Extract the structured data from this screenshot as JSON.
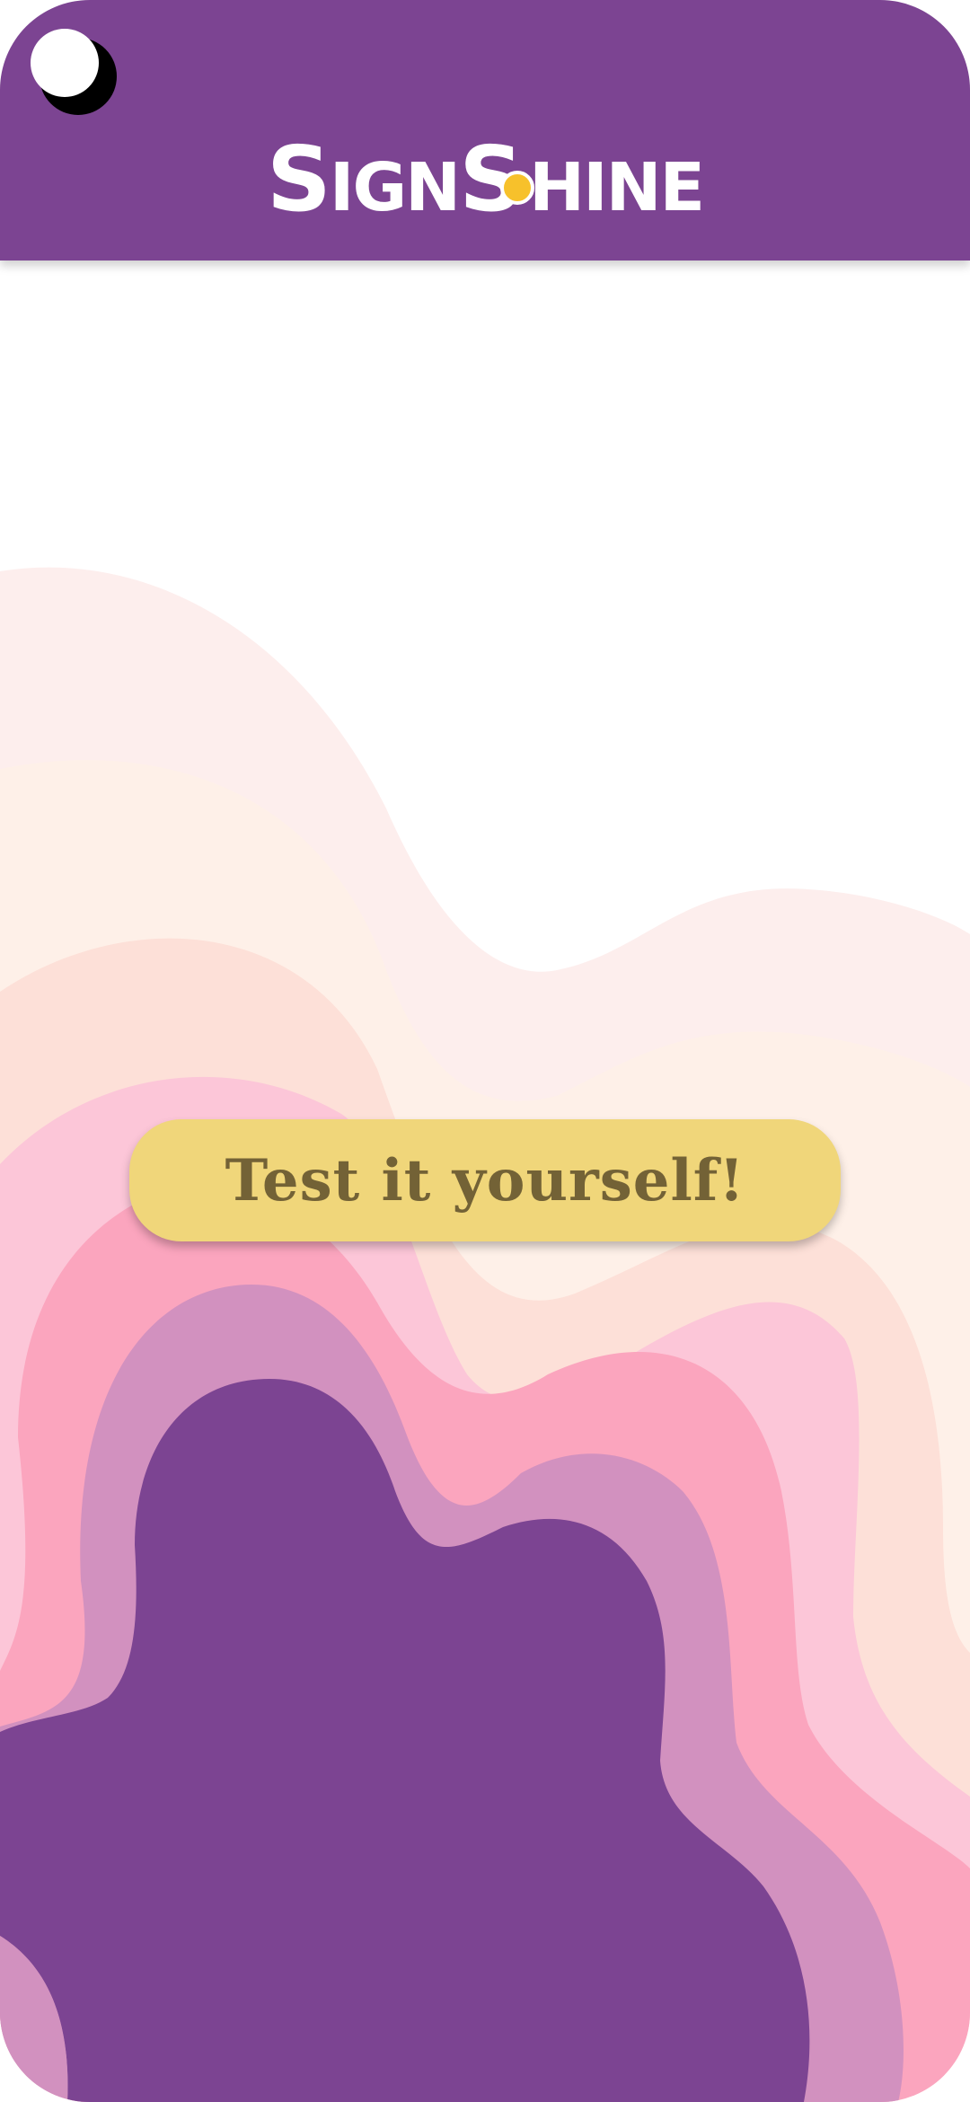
{
  "app": {
    "logo_text": "SIGNSHINE",
    "logo_parts": {
      "first": "S",
      "second": "IGN",
      "third": "S",
      "fourth": "HINE"
    },
    "logo_icon": "sun-icon"
  },
  "header": {
    "menu_icon": "menu-toggle-icon"
  },
  "main": {
    "cta_label": "Test it yourself!"
  },
  "colors": {
    "header_bg": "#7c4492",
    "button_bg": "#f0d67a",
    "button_text": "#736236",
    "wave_1": "#fdeeed",
    "wave_2": "#fef0e8",
    "wave_3": "#fde0d8",
    "wave_4": "#fcc6d8",
    "wave_5": "#fba5be",
    "wave_6": "#d291bf",
    "wave_7": "#7c4492"
  }
}
